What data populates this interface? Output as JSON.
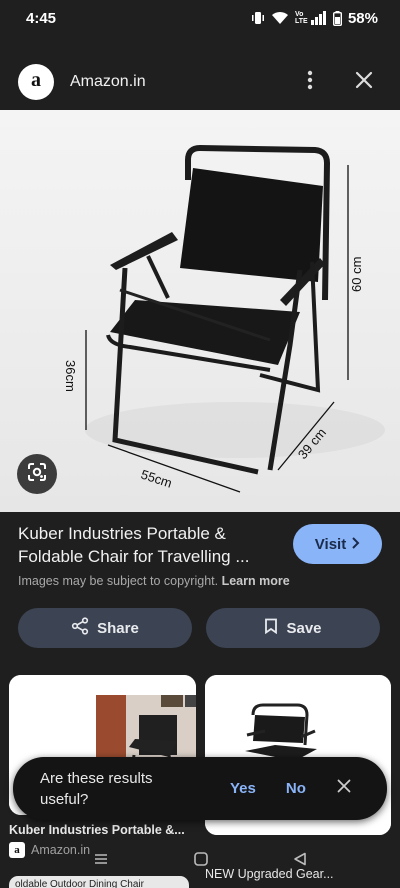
{
  "status_bar": {
    "time": "4:45",
    "volte": "Vo LTE",
    "battery": "58%"
  },
  "header": {
    "site_name": "Amazon.in",
    "logo_letter": "a"
  },
  "hero": {
    "dim_height": "60 cm",
    "dim_seat": "36cm",
    "dim_width": "55cm",
    "dim_depth": "39 cm"
  },
  "result": {
    "title": "Kuber Industries Portable & Foldable Chair for Travelling ...",
    "copyright_text": "Images may be subject to copyright.",
    "learn_more": "Learn more",
    "visit_label": "Visit"
  },
  "actions": {
    "share_label": "Share",
    "save_label": "Save"
  },
  "related": [
    {
      "title": "Kuber Industries Portable &...",
      "source": "Amazon.in",
      "source_logo": "a",
      "chip": "oldable Outdoor Dining Chair"
    },
    {
      "title": "NEW Upgraded Gear..."
    }
  ],
  "feedback": {
    "question": "Are these results useful?",
    "yes_label": "Yes",
    "no_label": "No"
  },
  "icons": [
    "vibrate-icon",
    "wifi-icon",
    "signal-icon",
    "battery-icon",
    "more-vert-icon",
    "close-icon",
    "lens-icon",
    "chevron-right-icon",
    "share-icon",
    "bookmark-icon",
    "recents-icon",
    "home-icon",
    "back-icon"
  ]
}
